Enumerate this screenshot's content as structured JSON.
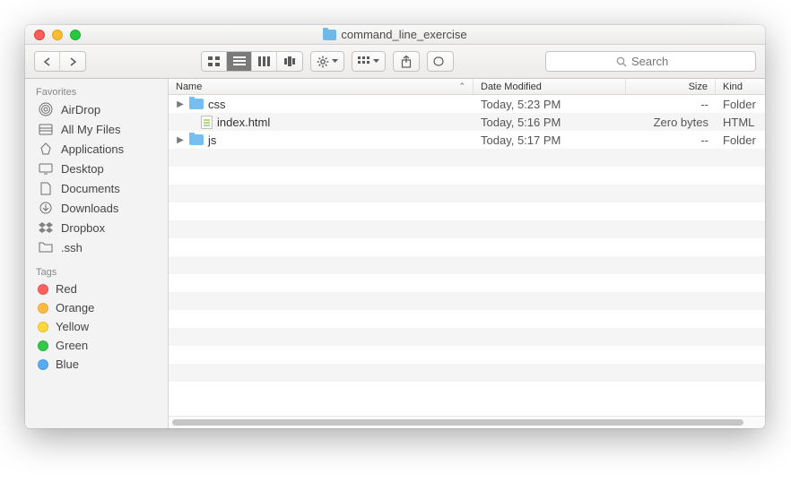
{
  "window": {
    "title": "command_line_exercise"
  },
  "toolbar": {
    "search_placeholder": "Search"
  },
  "sidebar": {
    "sections": [
      {
        "header": "Favorites",
        "items": [
          {
            "icon": "airdrop",
            "label": "AirDrop"
          },
          {
            "icon": "allfiles",
            "label": "All My Files"
          },
          {
            "icon": "applications",
            "label": "Applications"
          },
          {
            "icon": "desktop",
            "label": "Desktop"
          },
          {
            "icon": "documents",
            "label": "Documents"
          },
          {
            "icon": "downloads",
            "label": "Downloads"
          },
          {
            "icon": "dropbox",
            "label": "Dropbox"
          },
          {
            "icon": "folder",
            "label": ".ssh"
          }
        ]
      },
      {
        "header": "Tags",
        "items": [
          {
            "icon": "tag",
            "color": "#fc605c",
            "label": "Red"
          },
          {
            "icon": "tag",
            "color": "#fdbc40",
            "label": "Orange"
          },
          {
            "icon": "tag",
            "color": "#fdd83b",
            "label": "Yellow"
          },
          {
            "icon": "tag",
            "color": "#34c749",
            "label": "Green"
          },
          {
            "icon": "tag",
            "color": "#57acf5",
            "label": "Blue"
          }
        ]
      }
    ]
  },
  "columns": {
    "name": "Name",
    "date": "Date Modified",
    "size": "Size",
    "kind": "Kind"
  },
  "files": [
    {
      "type": "folder",
      "name": "css",
      "date": "Today, 5:23 PM",
      "size": "--",
      "kind": "Folder",
      "expandable": true
    },
    {
      "type": "file",
      "name": "index.html",
      "date": "Today, 5:16 PM",
      "size": "Zero bytes",
      "kind": "HTML",
      "expandable": false
    },
    {
      "type": "folder",
      "name": "js",
      "date": "Today, 5:17 PM",
      "size": "--",
      "kind": "Folder",
      "expandable": true
    }
  ]
}
